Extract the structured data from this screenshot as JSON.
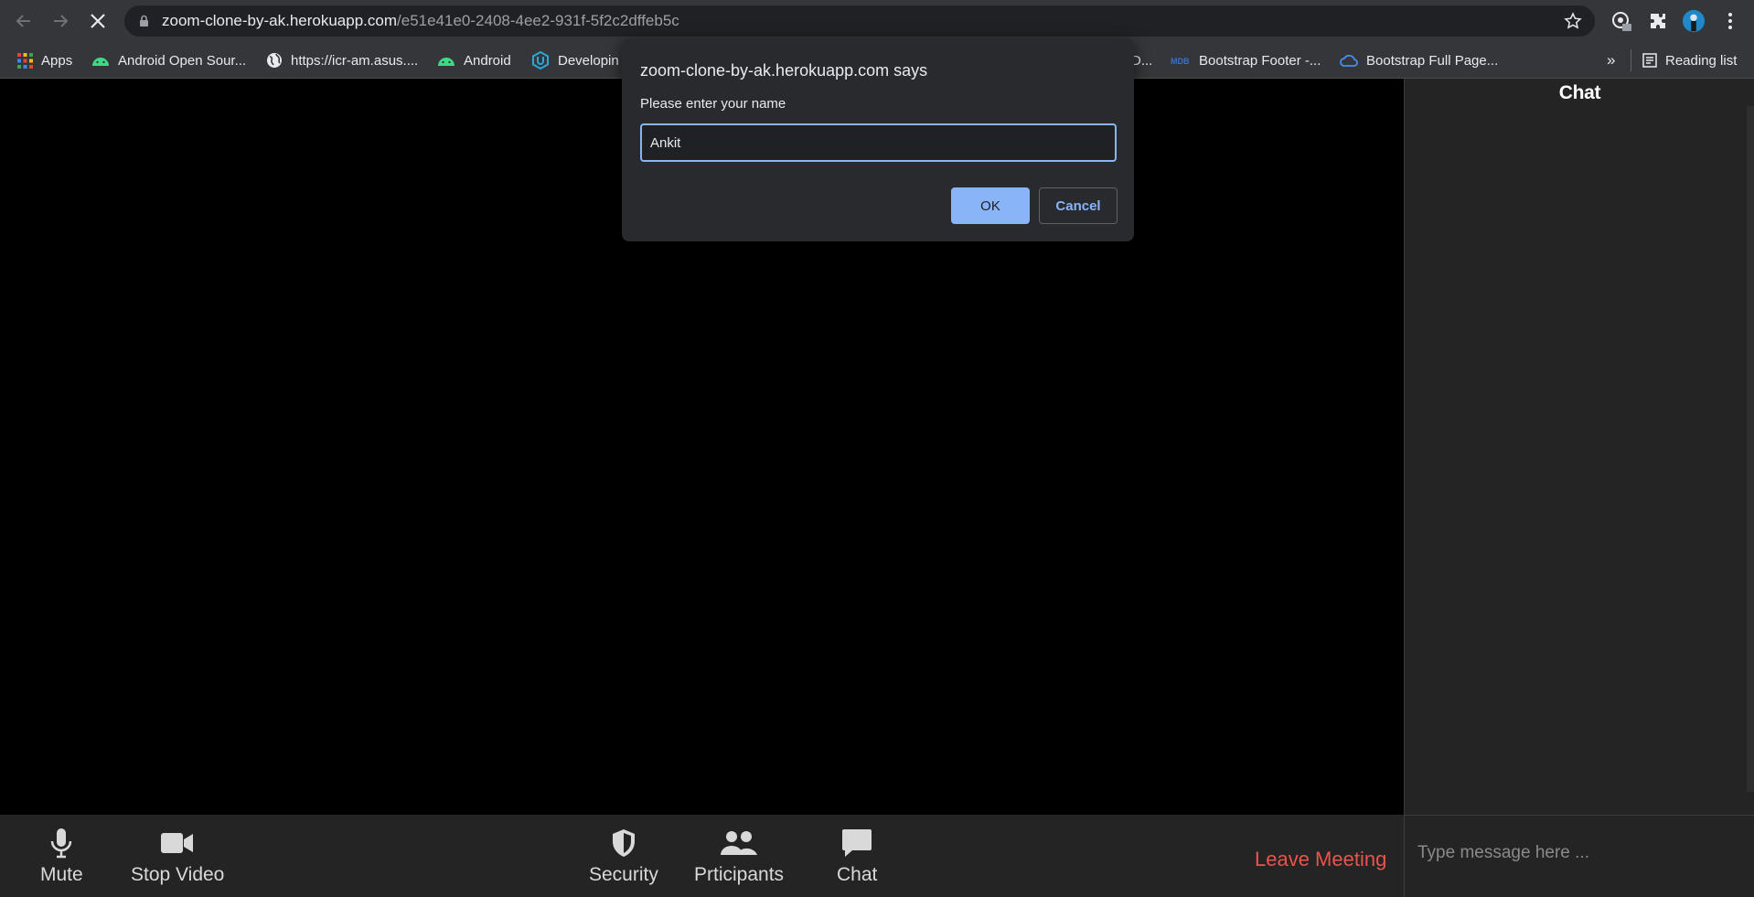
{
  "browser": {
    "url_host": "zoom-clone-by-ak.herokuapp.com",
    "url_path": "/e51e41e0-2408-4ee2-931f-5f2c2dffeb5c"
  },
  "bookmarks": [
    {
      "label": "Apps",
      "icon": "apps-grid-icon"
    },
    {
      "label": "Android Open Sour...",
      "icon": "android-icon"
    },
    {
      "label": "https://icr-am.asus....",
      "icon": "globe-icon"
    },
    {
      "label": "Android",
      "icon": "android-icon"
    },
    {
      "label": "Developin",
      "icon": "udacity-icon"
    },
    {
      "label": "D...",
      "icon": ""
    },
    {
      "label": "Bootstrap Footer -...",
      "icon": "mdb-icon"
    },
    {
      "label": "Bootstrap Full Page...",
      "icon": "cloud-icon"
    }
  ],
  "bookmarks_more": "»",
  "reading_list": "Reading list",
  "dialog": {
    "title": "zoom-clone-by-ak.herokuapp.com says",
    "message": "Please enter your name",
    "input_value": "Ankit",
    "ok_label": "OK",
    "cancel_label": "Cancel"
  },
  "chat": {
    "title": "Chat",
    "placeholder": "Type message here ..."
  },
  "controls": {
    "mute": "Mute",
    "stop_video": "Stop Video",
    "security": "Security",
    "participants": "Prticipants",
    "chat": "Chat",
    "leave": "Leave Meeting"
  },
  "colors": {
    "accent": "#8ab4f8",
    "leave": "#eb534b",
    "panel": "#242424"
  }
}
